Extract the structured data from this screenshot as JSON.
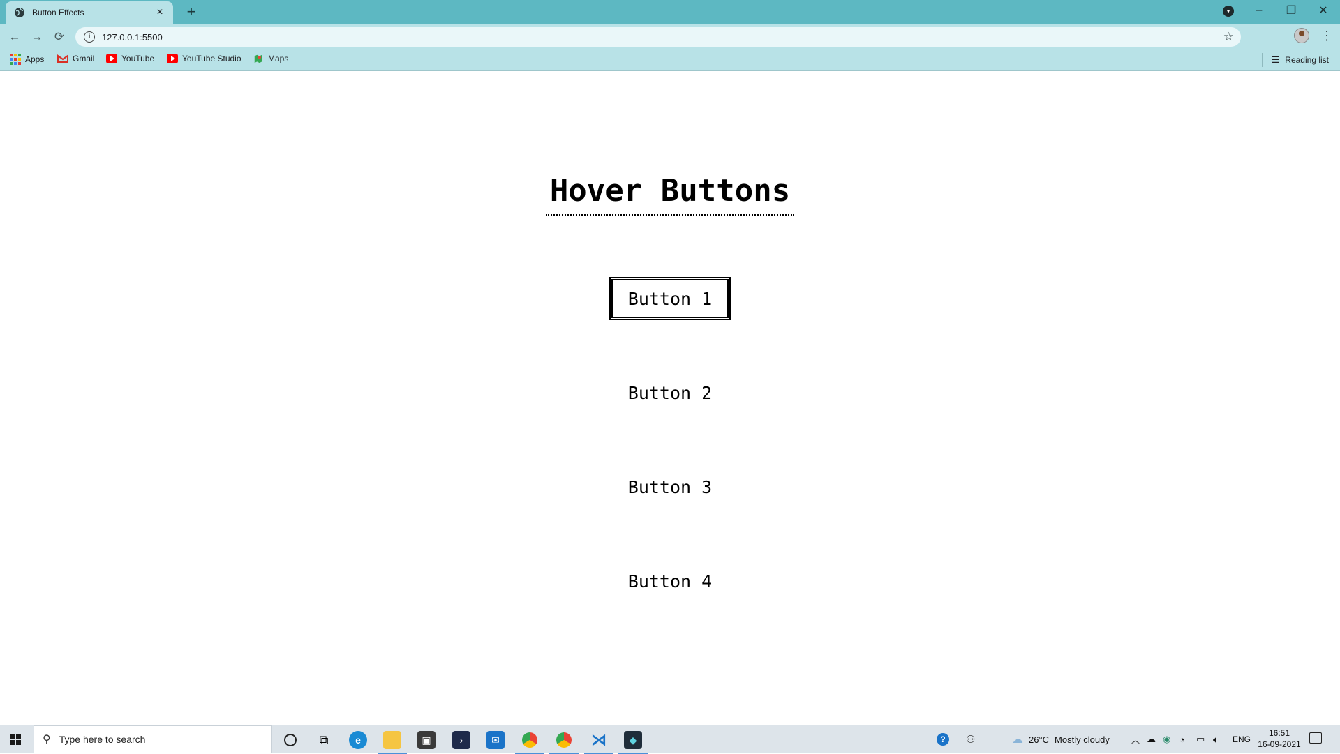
{
  "browser": {
    "tab_title": "Button Effects",
    "tab_close": "×",
    "new_tab": "+",
    "url": "127.0.0.1:5500",
    "window_controls": {
      "minimize": "–",
      "restore": "❐",
      "close": "✕"
    },
    "bookmarks": [
      {
        "label": "Apps",
        "icon": "apps-grid-icon"
      },
      {
        "label": "Gmail",
        "icon": "gmail-icon"
      },
      {
        "label": "YouTube",
        "icon": "youtube-icon"
      },
      {
        "label": "YouTube Studio",
        "icon": "youtube-studio-icon"
      },
      {
        "label": "Maps",
        "icon": "maps-icon"
      }
    ],
    "reading_list": "Reading list"
  },
  "page": {
    "heading": "Hover Buttons",
    "buttons": [
      {
        "label": "Button 1"
      },
      {
        "label": "Button 2"
      },
      {
        "label": "Button 3"
      },
      {
        "label": "Button 4"
      }
    ]
  },
  "taskbar": {
    "search_placeholder": "Type here to search",
    "weather_temp": "26°C",
    "weather_desc": "Mostly cloudy",
    "language": "ENG",
    "time": "16:51",
    "date": "16-09-2021"
  },
  "colors": {
    "tab_bar": "#5db8c2",
    "toolbar": "#b8e2e7",
    "page_background": "#ffffff",
    "taskbar": "#dde4ea"
  }
}
